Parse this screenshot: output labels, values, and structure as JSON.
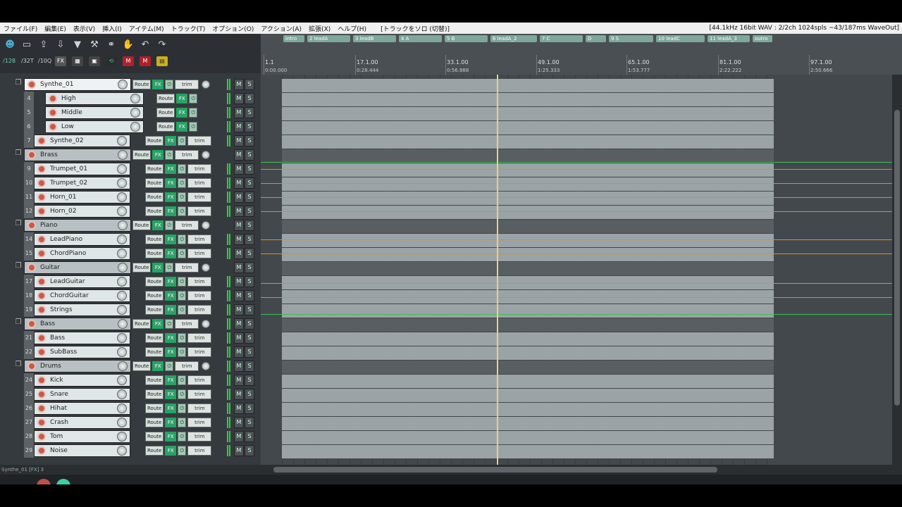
{
  "menu": {
    "items": [
      "ファイル(F)",
      "編集(E)",
      "表示(V)",
      "挿入(I)",
      "アイテム(M)",
      "トラック(T)",
      "オプション(O)",
      "アクション(A)",
      "拡張(X)",
      "ヘルプ(H)"
    ],
    "solo_toggle": "[トラックをソロ (切替)]",
    "audio_status": "[44.1kHz 16bit WAV : 2/2ch 1024spls ~43/187ms WaveOut]"
  },
  "toolbar": {
    "grid_a": "/128",
    "grid_b": "/32T",
    "grid_c": "/10Q"
  },
  "regions": [
    {
      "label": "intro"
    },
    {
      "label": "2 leadA"
    },
    {
      "label": "3 leadB"
    },
    {
      "label": "4 A"
    },
    {
      "label": "5 B"
    },
    {
      "label": "6 leadA_2"
    },
    {
      "label": "7 C"
    },
    {
      "label": "D"
    },
    {
      "label": "9 S"
    },
    {
      "label": "10 leadC"
    },
    {
      "label": "11 leadA_3"
    },
    {
      "label": "outro"
    }
  ],
  "ruler": {
    "bars": [
      "1.1",
      "17.1.00",
      "33.1.00",
      "49.1.00",
      "65.1.00",
      "81.1.00",
      "97.1.00"
    ],
    "times": [
      "0:00.000",
      "0:28.444",
      "0:56.888",
      "1:25.333",
      "1:53.777",
      "2:22.222",
      "2:50.666"
    ]
  },
  "tracks": [
    {
      "num": "",
      "name": "Synthe_01",
      "folder": true
    },
    {
      "num": "4",
      "name": "High"
    },
    {
      "num": "5",
      "name": "Middle"
    },
    {
      "num": "6",
      "name": "Low"
    },
    {
      "num": "7",
      "name": "Synthe_02"
    },
    {
      "num": "",
      "name": "Brass",
      "folder": true
    },
    {
      "num": "9",
      "name": "Trumpet_01"
    },
    {
      "num": "10",
      "name": "Trumpet_02"
    },
    {
      "num": "11",
      "name": "Horn_01"
    },
    {
      "num": "12",
      "name": "Horn_02"
    },
    {
      "num": "",
      "name": "Piano",
      "folder": true
    },
    {
      "num": "14",
      "name": "LeadPiano"
    },
    {
      "num": "15",
      "name": "ChordPiano"
    },
    {
      "num": "",
      "name": "Guitar",
      "folder": true
    },
    {
      "num": "17",
      "name": "LeadGuitar"
    },
    {
      "num": "18",
      "name": "ChordGuitar"
    },
    {
      "num": "19",
      "name": "Strings"
    },
    {
      "num": "",
      "name": "Bass",
      "folder": true
    },
    {
      "num": "21",
      "name": "Bass"
    },
    {
      "num": "22",
      "name": "SubBass"
    },
    {
      "num": "",
      "name": "Drums",
      "folder": true
    },
    {
      "num": "24",
      "name": "Kick"
    },
    {
      "num": "25",
      "name": "Snare"
    },
    {
      "num": "26",
      "name": "Hihat"
    },
    {
      "num": "27",
      "name": "Crash"
    },
    {
      "num": "28",
      "name": "Tom"
    },
    {
      "num": "29",
      "name": "Noise"
    }
  ],
  "labels": {
    "route": "Route",
    "fx": "FX",
    "trim": "trim",
    "mute": "M",
    "solo": "S"
  },
  "status_line": "Synthe_01 [FX] 3",
  "colors": {
    "accent": "#2da06a",
    "envelope": "#d49224",
    "cursor": "#e7d86a"
  }
}
